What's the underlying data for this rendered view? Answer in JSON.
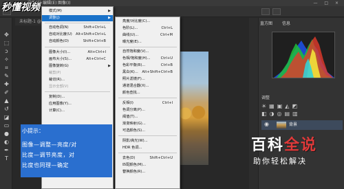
{
  "menubar": {
    "items": [
      "文件(F)",
      "编辑(E)",
      "图像(I)"
    ],
    "window_buttons": "— □ ×"
  },
  "doc_tab": "未标题-1 @ ...",
  "watermark": "秒懂视频",
  "image_menu": {
    "items": [
      {
        "label": "模式(M)",
        "shortcut": "",
        "submenu": true,
        "disabled": false
      },
      {
        "label": "调整(J)",
        "shortcut": "",
        "submenu": true,
        "disabled": false,
        "highlighted": true
      },
      {
        "label": "自动色调(N)",
        "shortcut": "Shift+Ctrl+L",
        "submenu": false,
        "disabled": false
      },
      {
        "label": "自动对比度(U)",
        "shortcut": "Alt+Shift+Ctrl+L",
        "submenu": false,
        "disabled": false
      },
      {
        "label": "自动颜色(O)",
        "shortcut": "Shift+Ctrl+B",
        "submenu": false,
        "disabled": false
      },
      {
        "label": "图像大小(I)...",
        "shortcut": "Alt+Ctrl+I",
        "submenu": false,
        "disabled": false
      },
      {
        "label": "画布大小(S)...",
        "shortcut": "Alt+Ctrl+C",
        "submenu": false,
        "disabled": false
      },
      {
        "label": "图像旋转(G)",
        "shortcut": "",
        "submenu": true,
        "disabled": false
      },
      {
        "label": "裁剪(P)",
        "shortcut": "",
        "submenu": false,
        "disabled": true
      },
      {
        "label": "裁切(R)...",
        "shortcut": "",
        "submenu": false,
        "disabled": false
      },
      {
        "label": "显示全部(V)",
        "shortcut": "",
        "submenu": false,
        "disabled": true
      },
      {
        "label": "复制(D)...",
        "shortcut": "",
        "submenu": false,
        "disabled": false
      },
      {
        "label": "应用图像(Y)...",
        "shortcut": "",
        "submenu": false,
        "disabled": false
      },
      {
        "label": "计算(C)...",
        "shortcut": "",
        "submenu": false,
        "disabled": false
      }
    ]
  },
  "adjust_menu": {
    "items": [
      {
        "label": "亮度/对比度(C)...",
        "shortcut": ""
      },
      {
        "label": "色阶(L)...",
        "shortcut": "Ctrl+L"
      },
      {
        "label": "曲线(U)...",
        "shortcut": "Ctrl+M"
      },
      {
        "label": "曝光度(E)...",
        "shortcut": ""
      },
      {
        "label": "自然饱和度(V)...",
        "shortcut": ""
      },
      {
        "label": "色相/饱和度(H)...",
        "shortcut": "Ctrl+U"
      },
      {
        "label": "色彩平衡(B)...",
        "shortcut": "Ctrl+B"
      },
      {
        "label": "黑白(K)...",
        "shortcut": "Alt+Shift+Ctrl+B"
      },
      {
        "label": "照片滤镜(F)...",
        "shortcut": ""
      },
      {
        "label": "通道混合器(X)...",
        "shortcut": ""
      },
      {
        "label": "颜色查找...",
        "shortcut": ""
      },
      {
        "label": "反相(I)",
        "shortcut": "Ctrl+I"
      },
      {
        "label": "色调分离(P)...",
        "shortcut": ""
      },
      {
        "label": "阈值(T)...",
        "shortcut": ""
      },
      {
        "label": "渐变映射(G)...",
        "shortcut": ""
      },
      {
        "label": "可选颜色(S)...",
        "shortcut": ""
      },
      {
        "label": "阴影/高光(W)...",
        "shortcut": ""
      },
      {
        "label": "HDR 色调...",
        "shortcut": ""
      },
      {
        "label": "去色(D)",
        "shortcut": "Shift+Ctrl+U"
      },
      {
        "label": "匹配颜色(M)...",
        "shortcut": ""
      },
      {
        "label": "替换颜色(R)...",
        "shortcut": ""
      }
    ]
  },
  "right_panel": {
    "tabs": [
      "直方图",
      "信息"
    ],
    "adjust_tab": "调整",
    "layer_name": "背景"
  },
  "tip": {
    "title": "小提示：",
    "lines": [
      "图像—调整—亮度/对",
      "比度—调节亮度，对",
      "比度也同理—确定"
    ]
  },
  "brand": {
    "title_black": "百科",
    "title_accent": "全说",
    "subtitle": "助你轻松解决"
  },
  "colors": {
    "menu_highlight": "#1a72c9",
    "tip_bg": "#2a6fcf",
    "ps_dark": "#282828"
  }
}
